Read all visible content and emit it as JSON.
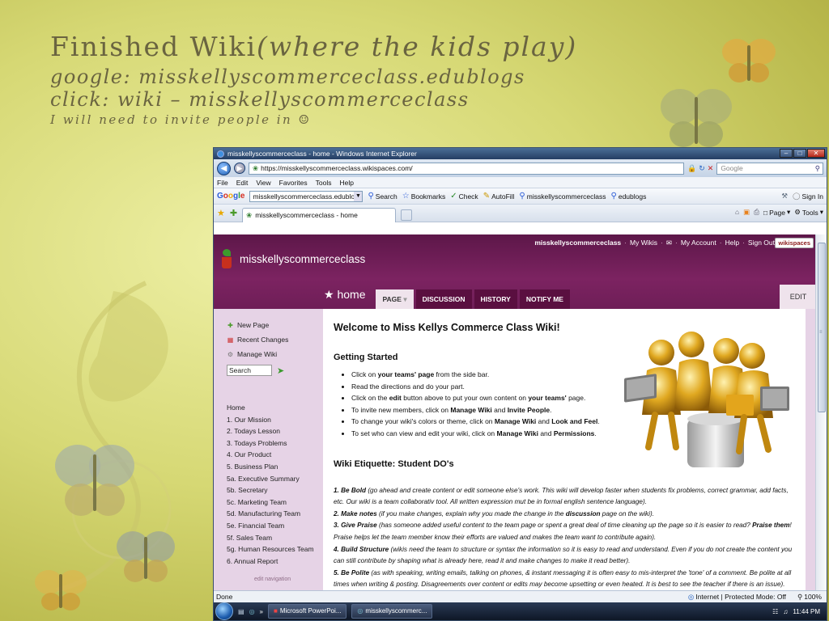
{
  "slide": {
    "title_main": "Finished Wiki",
    "title_italic": "(where the kids play)",
    "line2": "google: misskellyscommerceclass.edublogs",
    "line3": "click: wiki – misskellyscommerceclass",
    "line4": "I will need to invite people in ☺"
  },
  "browser": {
    "window_title": "misskellyscommerceclass - home - Windows Internet Explorer",
    "url": "https://misskellyscommerceclass.wikispaces.com/",
    "search_placeholder": "Google",
    "menu": [
      "File",
      "Edit",
      "View",
      "Favorites",
      "Tools",
      "Help"
    ],
    "google_toolbar": {
      "query": "misskellyscommerceclass.edublogs",
      "search_label": "Search",
      "bookmarks_label": "Bookmarks",
      "check_label": "Check",
      "autofill_label": "AutoFill",
      "term1": "misskellyscommerceclass",
      "term2": "edublogs",
      "signin_label": "Sign In"
    },
    "tab_title": "misskellyscommerceclass - home",
    "cmd": {
      "page": "Page",
      "tools": "Tools"
    },
    "status_left": "Done",
    "status_zone": "Internet | Protected Mode: Off",
    "zoom": "100%"
  },
  "wiki": {
    "name": "misskellyscommerceclass",
    "top_links": {
      "user": "misskellyscommerceclass",
      "my_wikis": "My Wikis",
      "my_account": "My Account",
      "help": "Help",
      "sign_out": "Sign Out"
    },
    "badge": "wikispaces",
    "home_label": "home",
    "tabs": [
      "PAGE",
      "DISCUSSION",
      "HISTORY",
      "NOTIFY ME"
    ],
    "edit_label": "EDIT",
    "tools": [
      "New Page",
      "Recent Changes",
      "Manage Wiki"
    ],
    "search_value": "Search",
    "nav": [
      "Home",
      "1. Our Mission",
      "2. Todays Lesson",
      "3. Todays Problems",
      "4. Our Product",
      "5. Business Plan",
      "5a. Executive Summary",
      "5b. Secretary",
      "5c. Marketing Team",
      "5d. Manufacturing Team",
      "5e. Financial Team",
      "5f. Sales Team",
      "5g. Human Resources Team",
      "6. Annual Report"
    ],
    "edit_nav": "edit navigation",
    "welcome": "Welcome to Miss Kellys Commerce Class Wiki!",
    "getting_started": "Getting Started",
    "steps": [
      {
        "pre": "Click on ",
        "bold": "your teams' page",
        "post": " from the side bar."
      },
      {
        "pre": "Read the directions and do your part.",
        "bold": "",
        "post": ""
      },
      {
        "pre": "Click on the ",
        "bold": "edit",
        "post": " button above to put your own content on ",
        "bold2": "your teams'",
        "post2": " page."
      },
      {
        "pre": "To invite new members, click on ",
        "bold": "Manage Wiki",
        "post": " and ",
        "bold2": "Invite People",
        "post2": "."
      },
      {
        "pre": "To change your wiki's colors or theme, click on ",
        "bold": "Manage Wiki",
        "post": " and ",
        "bold2": "Look and Feel",
        "post2": "."
      },
      {
        "pre": "To set who can view and edit your wiki, click on ",
        "bold": "Manage Wiki",
        "post": " and ",
        "bold2": "Permissions",
        "post2": "."
      }
    ],
    "etiquette_heading": "Wiki Etiquette:  Student DO's",
    "rules": [
      {
        "head": "1. Be Bold",
        "text": " (go ahead and create content or edit someone else's work. This wiki will develop faster when students fix problems, correct grammar, add facts, etc. Our wiki is a team collaborativ tool. All written expression mut be in formal english sentence language)."
      },
      {
        "head": "2. Make notes",
        "text": " (if you make changes, explain why you made the change in the ",
        "bold": "discussion",
        "text2": " page on the wiki)."
      },
      {
        "head": "3. Give Praise",
        "text": " (has someone added useful content to the team page or spent a great deal of time cleaning up the page so it is easier to read? ",
        "bold": "Praise them",
        "text2": "! Praise helps let the team member know their efforts are valued and makes the team want to contribute again)."
      },
      {
        "head": "4. Build Structure",
        "text": " (wikis need the team to structure or syntax the information so it is easy to read and understand. Even if you do not create the content you can still contribute by shaping what is already here, read it and make changes to make it read better)."
      },
      {
        "head": "5. Be Polite",
        "text": " (as with speaking, writing emails, talking on phones, & instant messaging it is often easy to mis-interpret the 'tone' of a comment. Be polite at all times when writing & posting. Disagreements over content or edits may become upsetting or even heated. It is best to see the teacher if there is an issue)."
      }
    ]
  },
  "taskbar": {
    "item1": "Microsoft PowerPoi...",
    "item2": "misskellyscommerc...",
    "time": "11:44 PM"
  },
  "colors": {
    "wiki_header": "#6e1e57",
    "wiki_sidebar": "#e6d3e6",
    "slide_bg": "#d6d874"
  }
}
